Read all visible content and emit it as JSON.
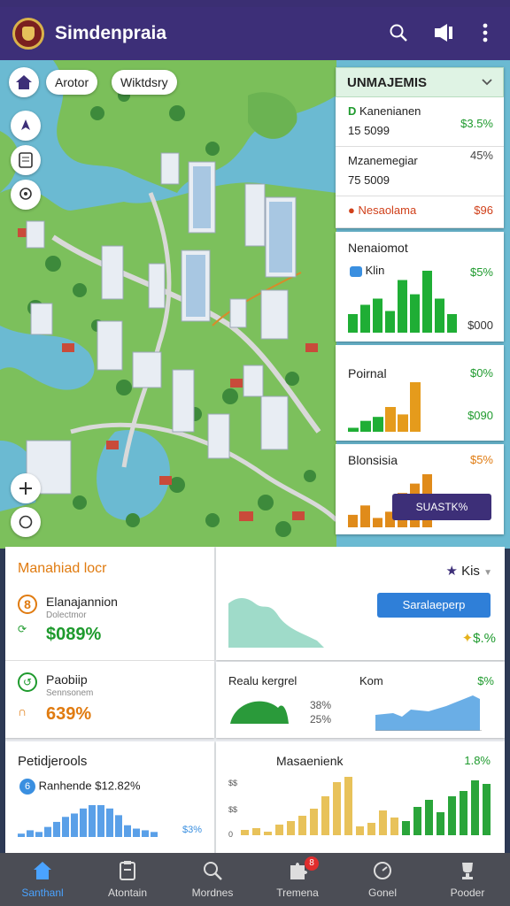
{
  "app": {
    "title": "Simdenpraia"
  },
  "map": {
    "chips": [
      "Arotor",
      "Wiktdsry"
    ]
  },
  "right_panel": {
    "header": "UNMAJEMIS",
    "rows": [
      {
        "label": "Kanenianen",
        "sub": "15 5099",
        "value": "$3.5%",
        "color": "#1e9a2d"
      },
      {
        "label": "Mzanemegiar",
        "sub": "75 5009",
        "value": "45%",
        "color": "#444444"
      },
      {
        "label": "Nesaolama",
        "sub": "",
        "value": "$96",
        "color": "#d0401a"
      }
    ],
    "charts": [
      {
        "title": "Nenaiomot",
        "tag": "Klin",
        "top_value": "$5%",
        "bottom_value": "$000",
        "values": [
          30,
          45,
          55,
          35,
          85,
          62,
          100,
          55,
          30
        ],
        "color": "#1fae35"
      },
      {
        "title": "Poirnal",
        "top_value": "$0%",
        "bottom_value": "$090",
        "values": [
          8,
          22,
          30,
          50,
          35,
          100
        ],
        "color": "#1fae35",
        "accent": "#e59b1c"
      },
      {
        "title": "Blonsisia",
        "top_value": "$5%",
        "bottom_value": "",
        "values": [
          20,
          35,
          15,
          25,
          55,
          70,
          85
        ],
        "color": "#e08b1a",
        "accent": "#e08b1a"
      }
    ],
    "button": "SUASTK%"
  },
  "bottom": {
    "section1": {
      "title": "Manahiad locr",
      "items": [
        {
          "name": "Elanajannion",
          "sub": "Dolectmor",
          "value": "$089%",
          "color": "#1e9a2d"
        },
        {
          "name": "Paobiip",
          "sub": "Sennsonem",
          "value": "639%",
          "color": "#e07b10"
        }
      ]
    },
    "section2": {
      "filter": "Kis",
      "button": "Saralaeperp",
      "value": "$.%"
    },
    "section3": {
      "label1": "Realu kergrel",
      "label2": "Kom",
      "v1": "38%",
      "v2": "25%",
      "v3": "$%"
    },
    "section4": {
      "title": "Petidjerools",
      "row": "Ranhende $12.82%",
      "value": "$3%"
    },
    "section5": {
      "title": "Masaenienk",
      "value": "1.8%",
      "axis_top": "$$",
      "axis_mid": "$$",
      "axis_bot": "0"
    }
  },
  "tabs": [
    {
      "label": "Santhanl",
      "icon": "home-icon",
      "active": true
    },
    {
      "label": "Atontain",
      "icon": "clipboard-icon",
      "active": false
    },
    {
      "label": "Mordnes",
      "icon": "search-icon",
      "active": false
    },
    {
      "label": "Tremena",
      "icon": "puzzle-icon",
      "active": false,
      "badge": "8"
    },
    {
      "label": "Gonel",
      "icon": "gauge-icon",
      "active": false
    },
    {
      "label": "Pooder",
      "icon": "trophy-icon",
      "active": false
    }
  ]
}
